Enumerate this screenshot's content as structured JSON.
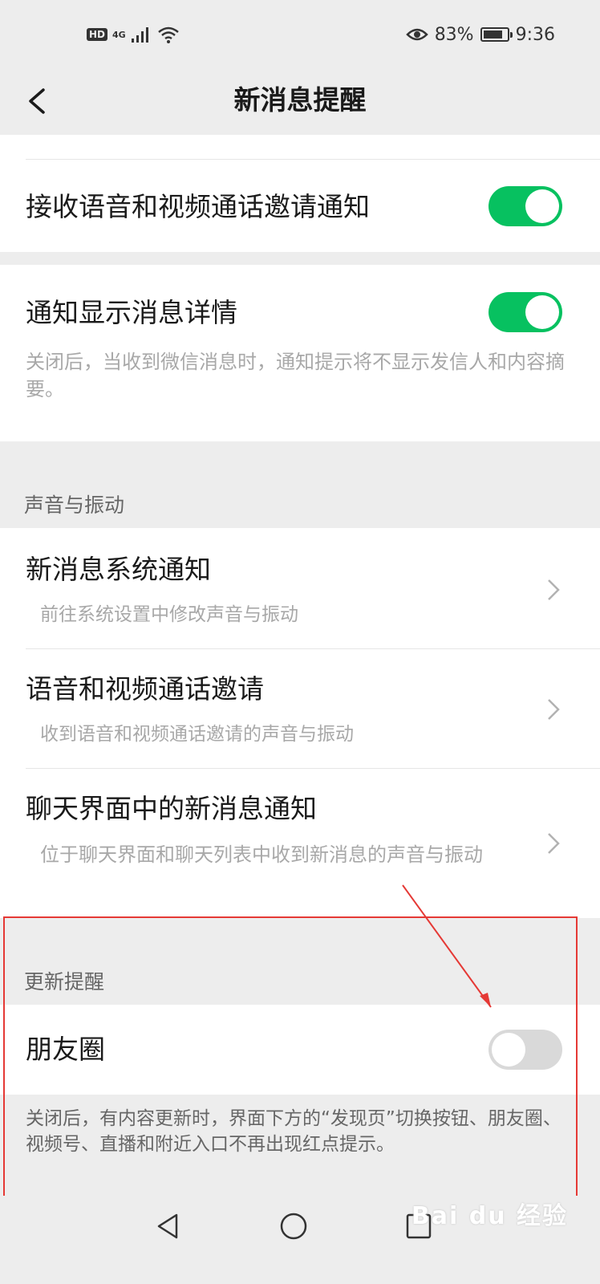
{
  "status_bar": {
    "left_indicators": [
      "HD",
      "4G"
    ],
    "battery_percent": "83%",
    "battery_level": 0.83,
    "time": "9:36"
  },
  "nav": {
    "title": "新消息提醒"
  },
  "settings": {
    "call_invite_notify": {
      "label": "接收语音和视频通话邀请通知",
      "enabled": true
    },
    "show_details": {
      "label": "通知显示消息详情",
      "enabled": true,
      "desc": "关闭后，当收到微信消息时，通知提示将不显示发信人和内容摘要。"
    },
    "sound_section": {
      "header": "声音与振动",
      "items": [
        {
          "label": "新消息系统通知",
          "desc": "前往系统设置中修改声音与振动"
        },
        {
          "label": "语音和视频通话邀请",
          "desc": "收到语音和视频通话邀请的声音与振动"
        },
        {
          "label": "聊天界面中的新消息通知",
          "desc": "位于聊天界面和聊天列表中收到新消息的声音与振动"
        }
      ]
    },
    "update_section": {
      "header": "更新提醒",
      "moments": {
        "label": "朋友圈",
        "enabled": false
      },
      "desc": "关闭后，有内容更新时，界面下方的“发现页”切换按钮、朋友圈、视频号、直播和附近入口不再出现红点提示。"
    }
  },
  "watermark": "Bai du 经验",
  "colors": {
    "toggle_on": "#07c160",
    "toggle_off": "#d9d9d9",
    "annotation": "#e53935"
  }
}
